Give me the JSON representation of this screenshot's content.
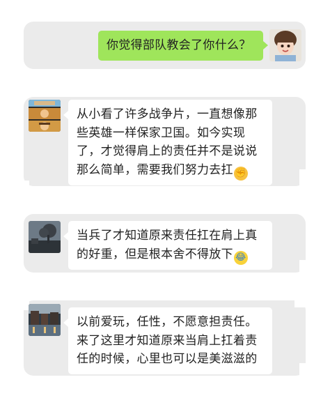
{
  "messages": [
    {
      "side": "right",
      "text_lines": [
        "你觉得部队教会了你什么？"
      ]
    },
    {
      "side": "left",
      "text_lines": [
        "从小看了许多战争片，一直想像那",
        "些英雄一样保家卫国。如今实现",
        "了，才觉得肩上的责任并不是说说",
        "那么简单，需要我们努力去扛"
      ],
      "emoji": "✊"
    },
    {
      "side": "left",
      "text_lines": [
        "当兵了才知道原来责任扛在肩上真",
        "的好重，但是根本舍不得放下"
      ],
      "emoji": "😂"
    },
    {
      "side": "left",
      "text_lines": [
        "以前爱玩，任性，不愿意担责任。",
        "来了这里才知道原来当肩上扛着责",
        "任的时候，心里也可以是美滋滋的"
      ]
    }
  ],
  "avatars": {
    "asker": "child-photo",
    "reply1": "soldier-photo-grid",
    "reply2": "dusk-tree-photo",
    "reply3": "city-night-photo"
  },
  "colors": {
    "panel": "#ebebeb",
    "sent_bubble": "#9fe55b",
    "received_bubble": "#ffffff",
    "text": "#222222"
  }
}
